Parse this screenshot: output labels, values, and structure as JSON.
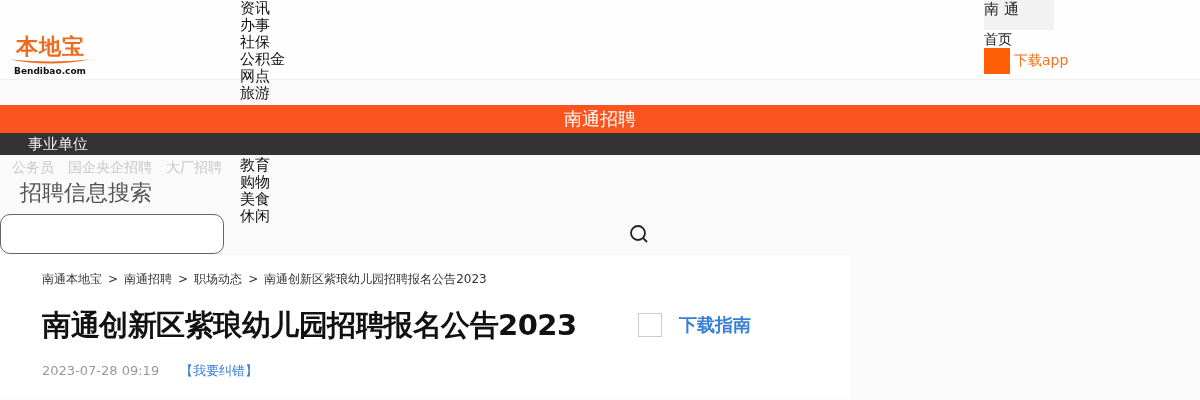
{
  "logo": {
    "text": "本地宝",
    "subtext": "Bendibao.com"
  },
  "nav": {
    "upper_items": [
      "资讯",
      "办事",
      "社保",
      "公积金",
      "网点",
      "旅游"
    ],
    "lower_items": [
      "教育",
      "购物",
      "美食",
      "休闲"
    ]
  },
  "city": "南 通",
  "home_link": "首页",
  "app_link": "下载app",
  "banner": {
    "title": "南通招聘"
  },
  "category_menu": {
    "active": "事业单位",
    "items": [
      "公务员",
      "国企央企招聘",
      "大厂招聘"
    ]
  },
  "search": {
    "title": "招聘信息搜索"
  },
  "article": {
    "breadcrumb": [
      "南通本地宝",
      "南通招聘",
      "职场动态",
      "南通创新区紫琅幼儿园招聘报名公告2023"
    ],
    "separator": ">",
    "title": "南通创新区紫琅幼儿园招聘报名公告2023",
    "download_link": "下载指南",
    "date": "2023-07-28 09:19",
    "report_link": "【我要纠错】"
  }
}
